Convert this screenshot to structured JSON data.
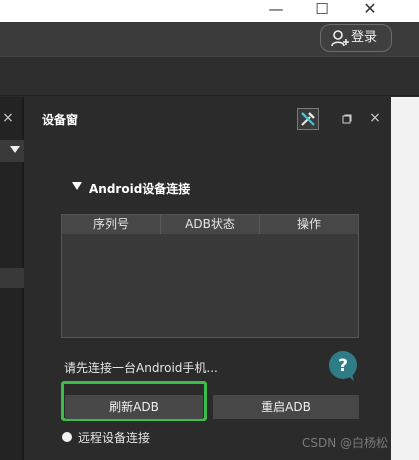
{
  "window": {
    "minimize_label": "—",
    "maximize_label": "☐",
    "close_label": "✕"
  },
  "header": {
    "login_label": "登录"
  },
  "left_panel": {
    "close_label": "×"
  },
  "device_panel": {
    "title": "设备窗",
    "close_label": "×",
    "section_title": "Android设备连接",
    "table": {
      "columns": [
        "序列号",
        "ADB状态",
        "操作"
      ],
      "rows": []
    },
    "hint": "请先连接一台Android手机...",
    "refresh_button": "刷新ADB",
    "restart_button": "重启ADB",
    "remote_option": "远程设备连接",
    "help_label": "?"
  },
  "watermark": "CSDN @白杨松",
  "colors": {
    "panel_bg": "#2b2b2b",
    "highlight_border": "#3bbd4a",
    "help_bg": "#2e7d86",
    "button_bg": "#474747"
  },
  "icons": {
    "user": "user-plus-icon",
    "tool": "tools-icon",
    "restore": "restore-icon",
    "help": "help-bubble-icon"
  }
}
